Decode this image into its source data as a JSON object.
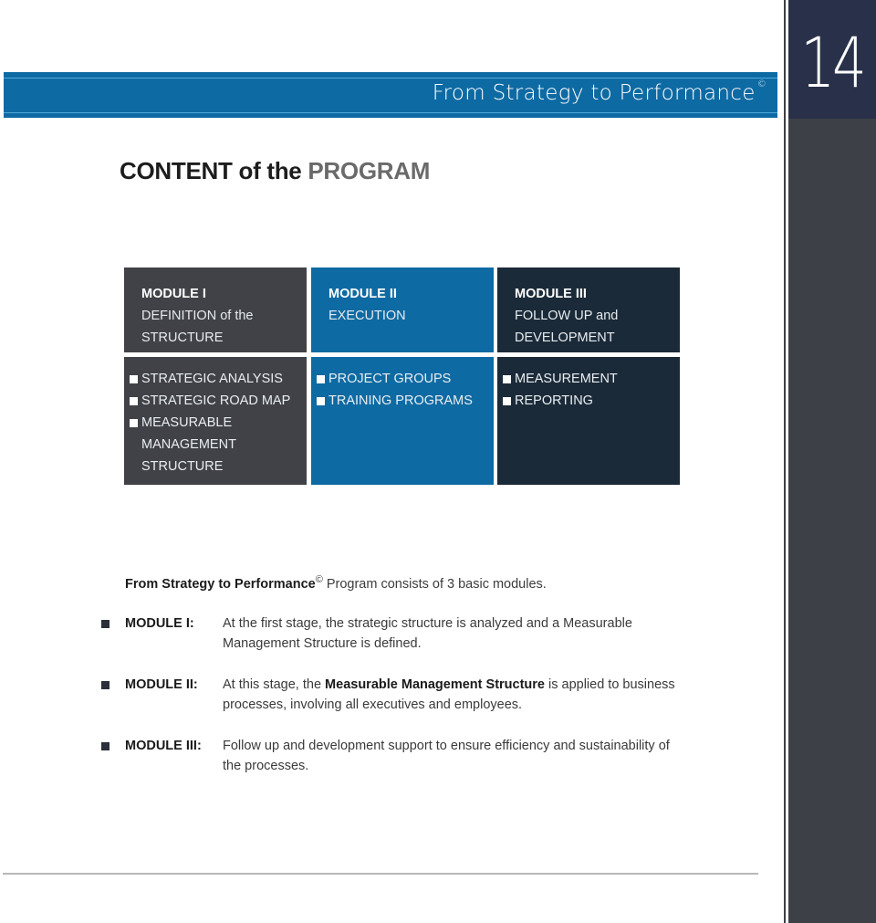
{
  "banner": {
    "title": "From Strategy to Performance",
    "copyright": "©"
  },
  "page_number": "14",
  "heading": {
    "main": "CONTENT of the ",
    "accent": "PROGRAM"
  },
  "modules": [
    {
      "title": "MODULE I",
      "subtitle_lines": [
        "DEFINITION of the",
        "STRUCTURE"
      ],
      "items": [
        [
          "STRATEGIC ANALYSIS"
        ],
        [
          "STRATEGIC ROAD MAP"
        ],
        [
          "MEASURABLE",
          "MANAGEMENT",
          "STRUCTURE"
        ]
      ]
    },
    {
      "title": "MODULE II",
      "subtitle_lines": [
        "EXECUTION",
        ""
      ],
      "items": [
        [
          "PROJECT GROUPS"
        ],
        [
          "TRAINING PROGRAMS"
        ]
      ]
    },
    {
      "title": "MODULE III",
      "subtitle_lines": [
        "FOLLOW UP and",
        "DEVELOPMENT"
      ],
      "items": [
        [
          "MEASUREMENT"
        ],
        [
          "REPORTING"
        ]
      ]
    }
  ],
  "intro": {
    "bold": "From Strategy to Performance",
    "copyright": "©",
    "rest": " Program consists of 3 basic modules."
  },
  "descriptions": [
    {
      "label": "MODULE I:",
      "pre": "At the first stage, the strategic structure is analyzed and a Measurable Management Structure is defined.",
      "bold": "",
      "post": ""
    },
    {
      "label": "MODULE II:",
      "pre": "At this stage, the ",
      "bold": "Measurable Management Structure",
      "post": " is applied to business processes, involving all executives and employees."
    },
    {
      "label": "MODULE III:",
      "pre": "Follow up and development support to ensure efficiency and sustainability of the processes.",
      "bold": "",
      "post": ""
    }
  ],
  "colors": {
    "banner": "#0e6aa3",
    "module1": "#404247",
    "module2": "#0e6aa3",
    "module3": "#1b2a38",
    "sidebar_top": "#29314a",
    "sidebar": "#3d4046"
  }
}
